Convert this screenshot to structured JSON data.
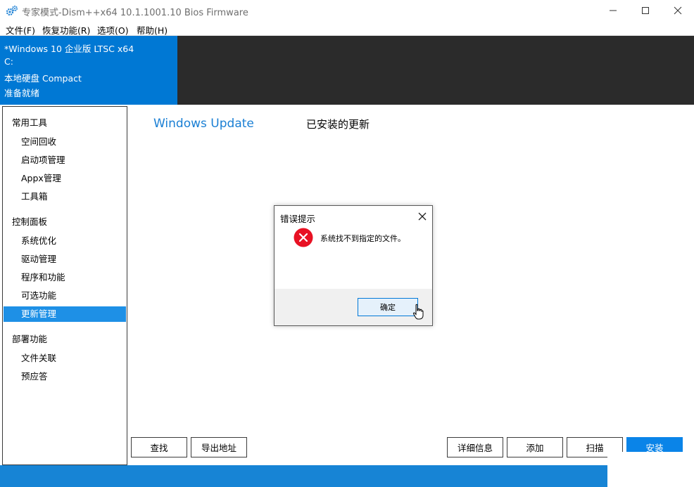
{
  "window": {
    "title": "专家模式-Dism++x64 10.1.1001.10 Bios Firmware",
    "icon": "gears-icon"
  },
  "menu": [
    "文件(F)",
    "恢复功能(R)",
    "选项(O)",
    "帮助(H)"
  ],
  "info": {
    "os": "*Windows 10 企业版 LTSC x64",
    "drive": "C:",
    "disk": "本地硬盘 Compact",
    "status": "准备就绪"
  },
  "nav": {
    "groups": [
      {
        "header": "常用工具",
        "items": [
          "空间回收",
          "启动项管理",
          "Appx管理",
          "工具箱"
        ]
      },
      {
        "header": "控制面板",
        "items": [
          "系统优化",
          "驱动管理",
          "程序和功能",
          "可选功能",
          "更新管理"
        ]
      },
      {
        "header": "部署功能",
        "items": [
          "文件关联",
          "预应答"
        ]
      }
    ],
    "selected": "更新管理"
  },
  "content": {
    "tabs": [
      "Windows Update",
      "已安装的更新"
    ],
    "buttons_left": [
      "查找",
      "导出地址"
    ],
    "buttons_right": [
      "详细信息",
      "添加",
      "扫描",
      "安装"
    ]
  },
  "dialog": {
    "title": "错误提示",
    "message": "系统找不到指定的文件。",
    "ok_label": "确定",
    "icon": "error-icon"
  },
  "colors": {
    "accent": "#0078d4",
    "dark_panel": "#2b2b2b",
    "selected": "#1e90e6",
    "error": "#e81123"
  }
}
